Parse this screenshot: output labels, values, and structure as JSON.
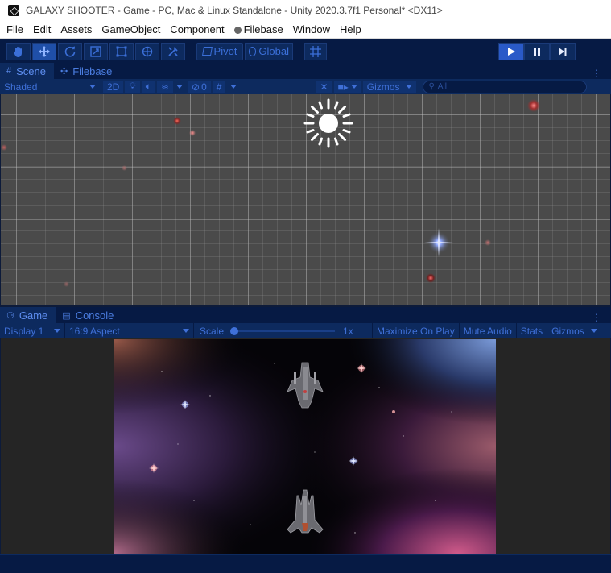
{
  "window": {
    "title": "GALAXY SHOOTER - Game - PC, Mac & Linux Standalone - Unity 2020.3.7f1 Personal* <DX11>"
  },
  "menu": [
    "File",
    "Edit",
    "Assets",
    "GameObject",
    "Component",
    "Filebase",
    "Window",
    "Help"
  ],
  "toolbar": {
    "tools": [
      "hand-icon",
      "move-icon",
      "rotate-icon",
      "scale-icon",
      "rect-icon",
      "transform-icon",
      "custom-tool-icon"
    ],
    "pivot_label": "Pivot",
    "global_label": "Global"
  },
  "scene_panel": {
    "tabs": [
      {
        "label": "Scene",
        "icon": "hash-icon"
      },
      {
        "label": "Filebase",
        "icon": "paw-icon"
      }
    ],
    "shading_mode": "Shaded",
    "mode_2d": "2D",
    "hidden_count": "0",
    "gizmos_label": "Gizmos",
    "search_placeholder": "All"
  },
  "game_panel": {
    "tabs": [
      {
        "label": "Game",
        "icon": "gamepad-icon"
      },
      {
        "label": "Console",
        "icon": "console-icon"
      }
    ],
    "display": "Display 1",
    "aspect": "16:9 Aspect",
    "scale_label": "Scale",
    "scale_value": "1x",
    "scale_fraction": 0.0,
    "maximize_label": "Maximize On Play",
    "mute_label": "Mute Audio",
    "stats_label": "Stats",
    "gizmos_label": "Gizmos"
  },
  "colors": {
    "accent": "#3f70d8",
    "panel": "#0d2a5e",
    "dark": "#061a44",
    "play_active": "#2a5ac8"
  }
}
